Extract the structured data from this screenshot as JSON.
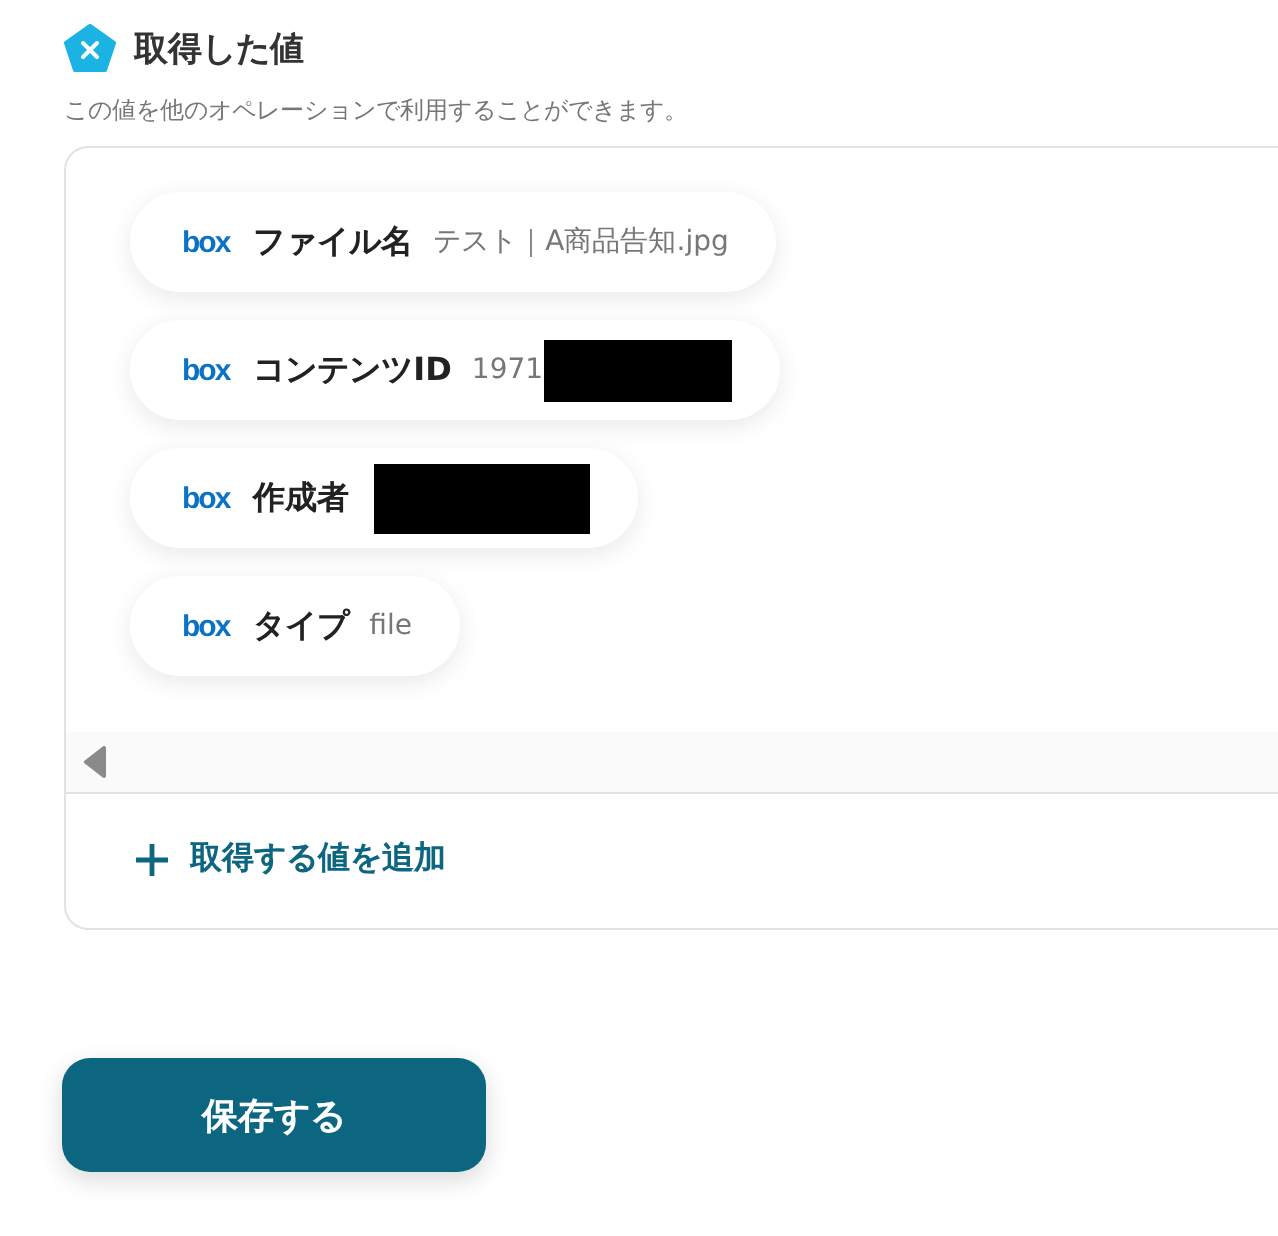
{
  "section": {
    "title": "取得した値",
    "description": "この値を他のオペレーションで利用することができます。"
  },
  "values": [
    {
      "source": "box",
      "label": "ファイル名",
      "value": "テスト｜A商品告知.jpg",
      "redacted": false
    },
    {
      "source": "box",
      "label": "コンテンツID",
      "value": "1971",
      "redacted": true
    },
    {
      "source": "box",
      "label": "作成者",
      "redacted": true
    },
    {
      "source": "box",
      "label": "タイプ",
      "value": "file",
      "redacted": false
    }
  ],
  "add_button": {
    "label": "取得する値を追加"
  },
  "save_button": {
    "label": "保存する"
  }
}
